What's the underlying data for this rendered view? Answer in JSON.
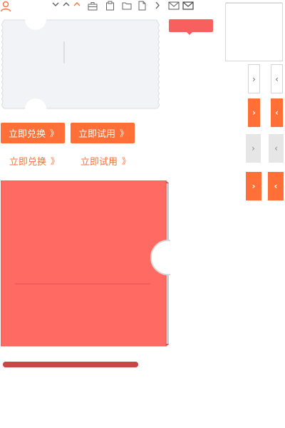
{
  "toolbar": {
    "icons": [
      "user-icon",
      "chevron-down-icon",
      "chevron-up-icon",
      "chevron-up-active-icon",
      "briefcase-icon",
      "clipboard-icon",
      "folder-icon",
      "file-icon",
      "chevron-right-icon",
      "mail-icon",
      "mail-open-icon"
    ]
  },
  "buttons": {
    "redeem_label": "立即兑换",
    "trial_label": "立即试用",
    "arrows": "》"
  },
  "links": {
    "redeem_label": "立即兑换",
    "trial_label": "立即试用",
    "arrows": "》"
  },
  "tiles": {
    "next": "›",
    "prev": "‹"
  },
  "progress": {
    "value": 1.0
  },
  "colors": {
    "accent": "#ff6f37",
    "coupon_red": "#ff6b63",
    "coupon_grey": "#f2f3f7",
    "bar": "#c94646"
  }
}
